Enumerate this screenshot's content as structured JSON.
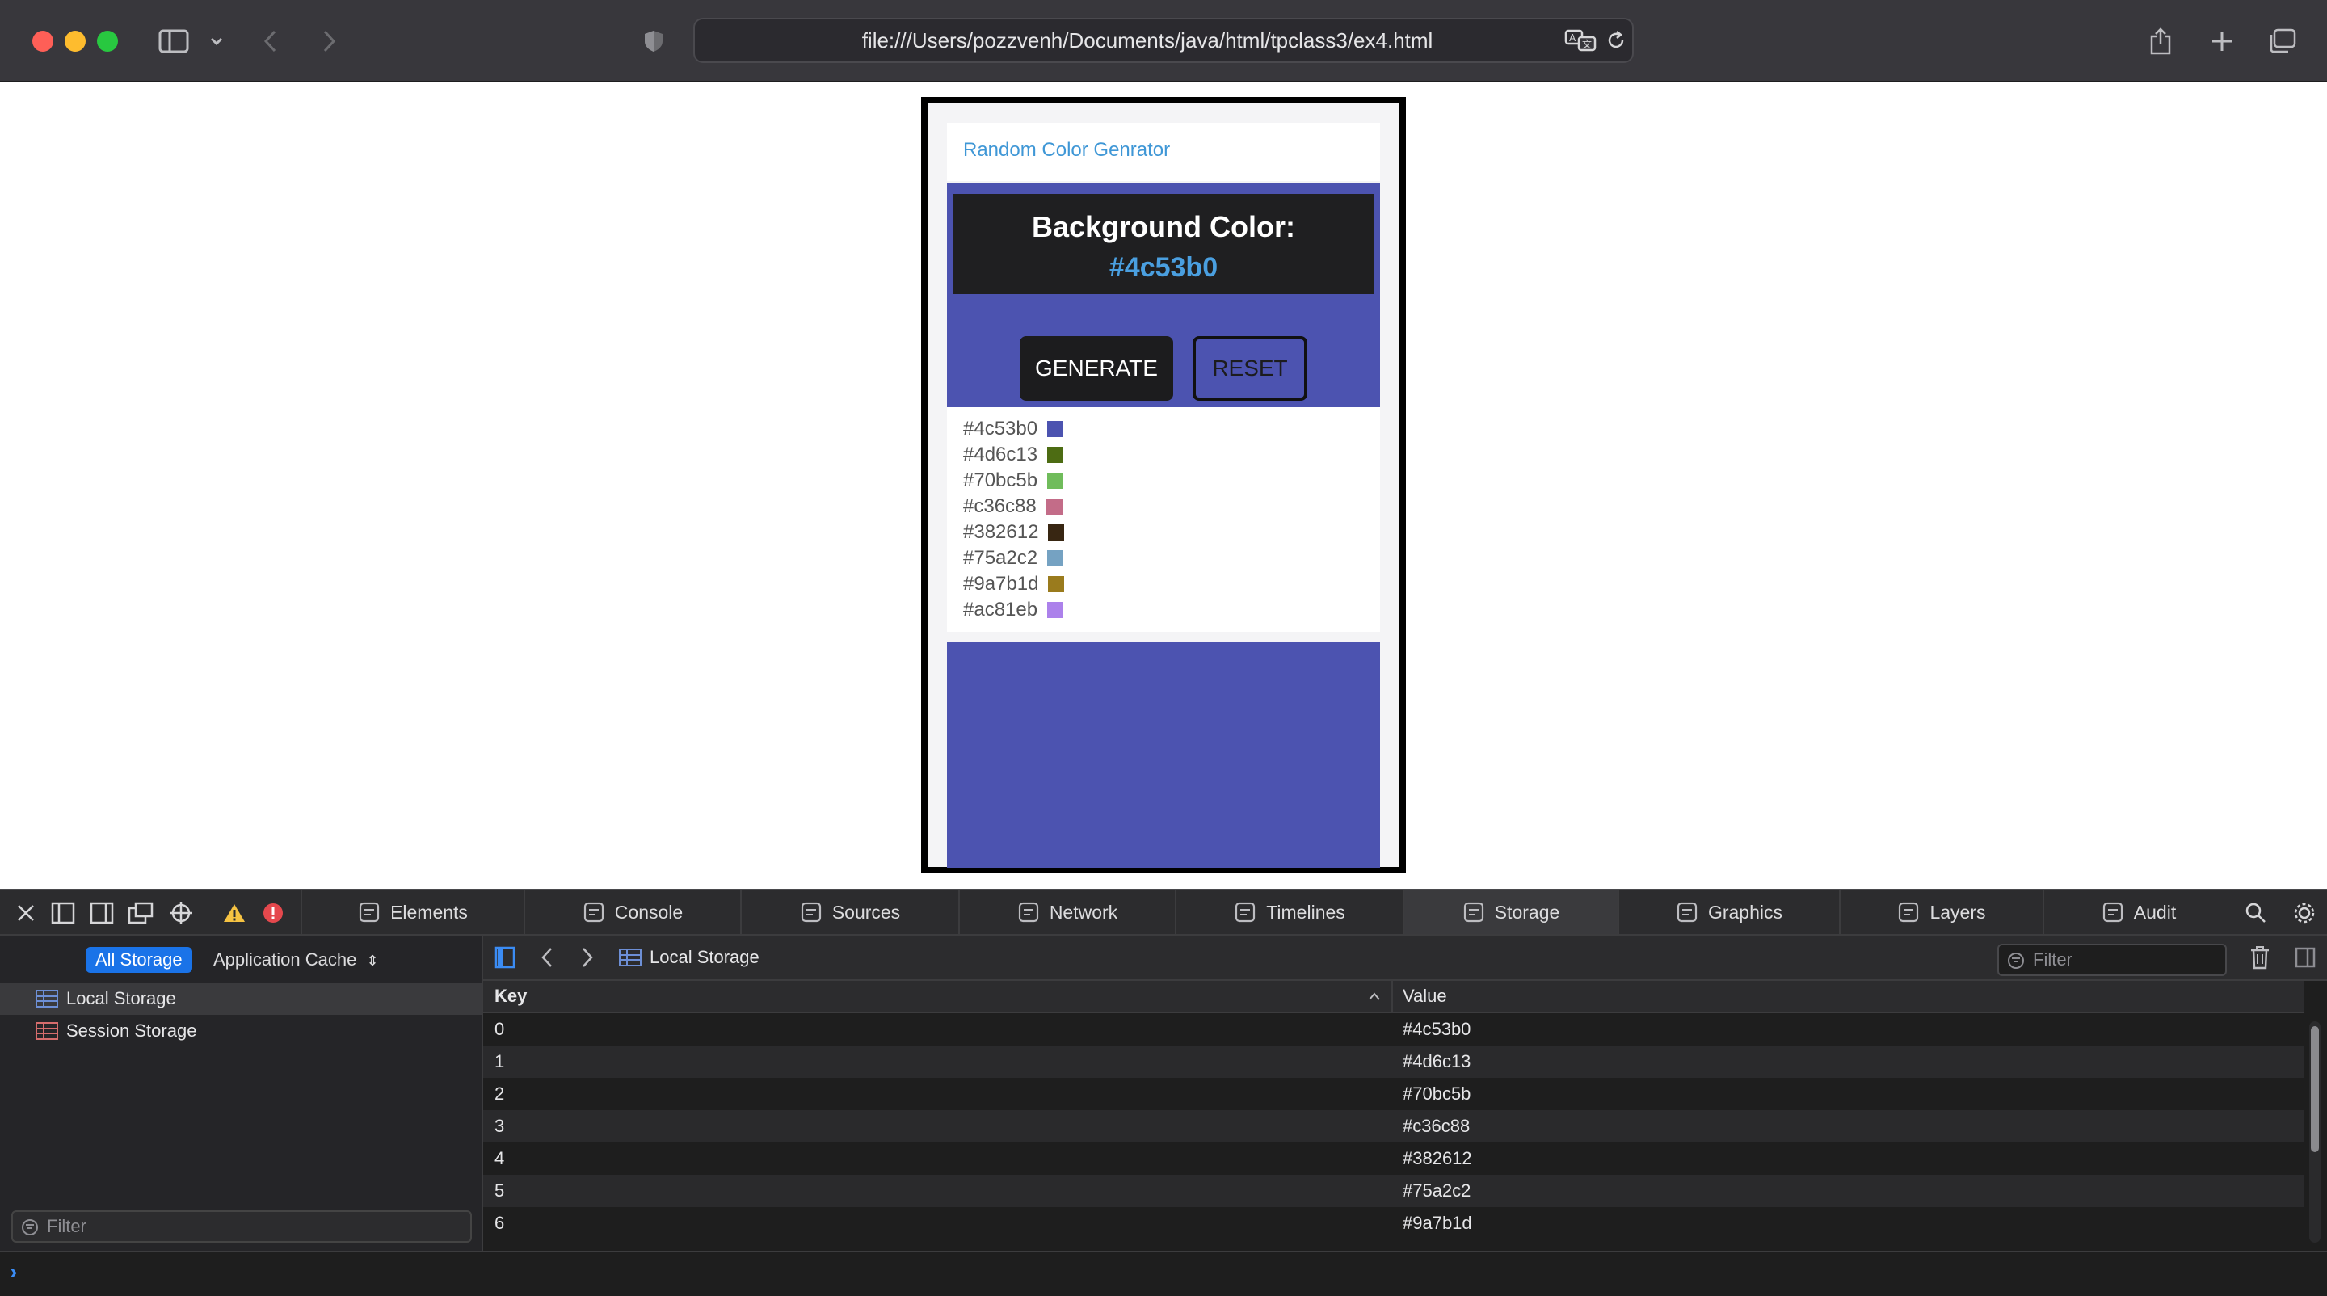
{
  "browser": {
    "url": "file:///Users/pozzvenh/Documents/java/html/tpclass3/ex4.html"
  },
  "page": {
    "title_link": "Random Color Genrator",
    "bg_color_label": "Background Color:",
    "current_color": "#4c53b0",
    "generate_label": "GENERATE",
    "reset_label": "RESET",
    "history": [
      {
        "hex": "#4c53b0",
        "color": "#4c53b0"
      },
      {
        "hex": "#4d6c13",
        "color": "#4d6c13"
      },
      {
        "hex": "#70bc5b",
        "color": "#70bc5b"
      },
      {
        "hex": "#c36c88",
        "color": "#c36c88"
      },
      {
        "hex": "#382612",
        "color": "#382612"
      },
      {
        "hex": "#75a2c2",
        "color": "#75a2c2"
      },
      {
        "hex": "#9a7b1d",
        "color": "#9a7b1d"
      },
      {
        "hex": "#ac81eb",
        "color": "#ac81eb"
      }
    ]
  },
  "devtools": {
    "tabs": [
      {
        "label": "Elements",
        "icon": "elements-icon"
      },
      {
        "label": "Console",
        "icon": "console-icon"
      },
      {
        "label": "Sources",
        "icon": "sources-icon"
      },
      {
        "label": "Network",
        "icon": "network-icon"
      },
      {
        "label": "Timelines",
        "icon": "timelines-icon"
      },
      {
        "label": "Storage",
        "icon": "storage-icon"
      },
      {
        "label": "Graphics",
        "icon": "graphics-icon"
      },
      {
        "label": "Layers",
        "icon": "layers-icon"
      },
      {
        "label": "Audit",
        "icon": "audit-icon"
      }
    ],
    "selected_tab": "Storage",
    "sidebar": {
      "all_storage_label": "All Storage",
      "app_cache_label": "Application Cache",
      "items": [
        {
          "label": "Local Storage"
        },
        {
          "label": "Session Storage"
        }
      ],
      "filter_placeholder": "Filter"
    },
    "content": {
      "breadcrumb": "Local Storage",
      "filter_placeholder": "Filter",
      "columns": {
        "key": "Key",
        "value": "Value"
      },
      "rows": [
        {
          "key": "0",
          "value": "#4c53b0"
        },
        {
          "key": "1",
          "value": "#4d6c13"
        },
        {
          "key": "2",
          "value": "#70bc5b"
        },
        {
          "key": "3",
          "value": "#c36c88"
        },
        {
          "key": "4",
          "value": "#382612"
        },
        {
          "key": "5",
          "value": "#75a2c2"
        },
        {
          "key": "6",
          "value": "#9a7b1d"
        }
      ]
    }
  }
}
